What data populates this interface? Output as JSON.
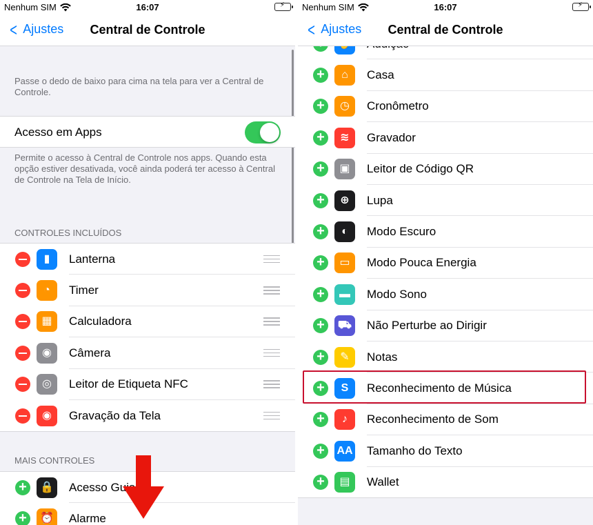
{
  "left": {
    "status": {
      "carrier": "Nenhum SIM",
      "time": "16:07"
    },
    "nav": {
      "back": "Ajustes",
      "title": "Central de Controle"
    },
    "intro": "Passe o dedo de baixo para cima na tela para ver a Central de Controle.",
    "access": {
      "label": "Acesso em Apps",
      "enabled": true
    },
    "access_info": "Permite o acesso à Central de Controle nos apps. Quando esta opção estiver desativada, você ainda poderá ter acesso à Central de Controle na Tela de Início.",
    "included_header": "CONTROLES INCLUÍDOS",
    "included": [
      {
        "label": "Lanterna",
        "icon": "flashlight-icon",
        "color": "#0a84ff"
      },
      {
        "label": "Timer",
        "icon": "timer-icon",
        "color": "#ff9500"
      },
      {
        "label": "Calculadora",
        "icon": "calculator-icon",
        "color": "#ff9500"
      },
      {
        "label": "Câmera",
        "icon": "camera-icon",
        "color": "#8e8e93"
      },
      {
        "label": "Leitor de Etiqueta NFC",
        "icon": "nfc-icon",
        "color": "#8e8e93"
      },
      {
        "label": "Gravação da Tela",
        "icon": "screen-recording-icon",
        "color": "#ff3b30"
      }
    ],
    "more_header": "MAIS CONTROLES",
    "more": [
      {
        "label": "Acesso Guiado",
        "icon": "guided-access-icon",
        "color": "#1c1c1e"
      },
      {
        "label": "Alarme",
        "icon": "alarm-icon",
        "color": "#ff9500"
      }
    ]
  },
  "right": {
    "status": {
      "carrier": "Nenhum SIM",
      "time": "16:07"
    },
    "nav": {
      "back": "Ajustes",
      "title": "Central de Controle"
    },
    "partial": {
      "label": "Audição",
      "icon": "hearing-icon",
      "color": "#0a84ff"
    },
    "more": [
      {
        "label": "Casa",
        "icon": "home-icon",
        "color": "#ff9500"
      },
      {
        "label": "Cronômetro",
        "icon": "stopwatch-icon",
        "color": "#ff9500"
      },
      {
        "label": "Gravador",
        "icon": "voice-memos-icon",
        "color": "#ff3b30"
      },
      {
        "label": "Leitor de Código QR",
        "icon": "qr-code-icon",
        "color": "#8e8e93"
      },
      {
        "label": "Lupa",
        "icon": "magnifier-icon",
        "color": "#1c1c1e"
      },
      {
        "label": "Modo Escuro",
        "icon": "dark-mode-icon",
        "color": "#1c1c1e"
      },
      {
        "label": "Modo Pouca Energia",
        "icon": "low-power-icon",
        "color": "#ff9500"
      },
      {
        "label": "Modo Sono",
        "icon": "sleep-icon",
        "color": "#34c7b8"
      },
      {
        "label": "Não Perturbe ao Dirigir",
        "icon": "car-icon",
        "color": "#5856d6"
      },
      {
        "label": "Notas",
        "icon": "notes-icon",
        "color": "#ffcc00"
      },
      {
        "label": "Reconhecimento de Música",
        "icon": "shazam-icon",
        "color": "#0a84ff"
      },
      {
        "label": "Reconhecimento de Som",
        "icon": "sound-recognition-icon",
        "color": "#ff3b30"
      },
      {
        "label": "Tamanho do Texto",
        "icon": "text-size-icon",
        "color": "#0a84ff"
      },
      {
        "label": "Wallet",
        "icon": "wallet-icon",
        "color": "#34c759"
      }
    ],
    "highlighted": "Reconhecimento de Música"
  },
  "glyphs": {
    "flashlight-icon": "▮",
    "timer-icon": "◔",
    "calculator-icon": "▦",
    "camera-icon": "◉",
    "nfc-icon": "◎",
    "screen-recording-icon": "◉",
    "guided-access-icon": "🔒",
    "alarm-icon": "⏰",
    "hearing-icon": "✋",
    "home-icon": "⌂",
    "stopwatch-icon": "◷",
    "voice-memos-icon": "≋",
    "qr-code-icon": "▣",
    "magnifier-icon": "⊕",
    "dark-mode-icon": "◐",
    "low-power-icon": "▭",
    "sleep-icon": "▬",
    "car-icon": "⛟",
    "notes-icon": "✎",
    "shazam-icon": "S",
    "sound-recognition-icon": "♪",
    "text-size-icon": "AA",
    "wallet-icon": "▤"
  }
}
